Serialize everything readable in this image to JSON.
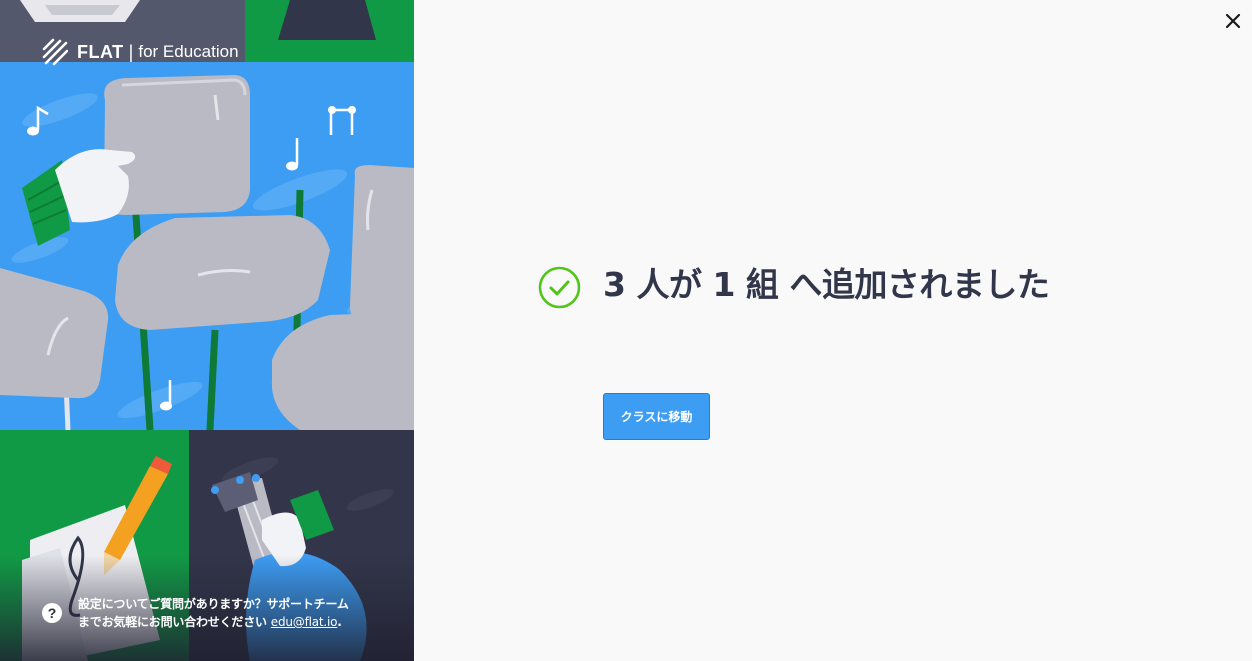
{
  "brand": {
    "name": "FLAT",
    "separator": "|",
    "subtitle": "for Education",
    "logo_icon": "flat-logo-icon"
  },
  "help": {
    "icon": "question-mark-icon",
    "icon_glyph": "?",
    "line1": "設定についてご質問がありますか？サポートチーム",
    "line2_prefix": "までお気軽にお問い合わせください ",
    "email": "edu@flat.io",
    "line2_suffix": "."
  },
  "dialog": {
    "close_icon": "close-icon",
    "success_icon": "check-circle-icon",
    "title": "3 人が 1 組 へ追加されました",
    "button_label": "クラスに移動"
  },
  "colors": {
    "background": "#f9f9f9",
    "title_text": "#32364a",
    "success_green": "#52c41a",
    "button_blue": "#3d9df3",
    "illustration_blue": "#3d9df3",
    "illustration_green": "#119a45",
    "illustration_navy": "#2f3144"
  }
}
